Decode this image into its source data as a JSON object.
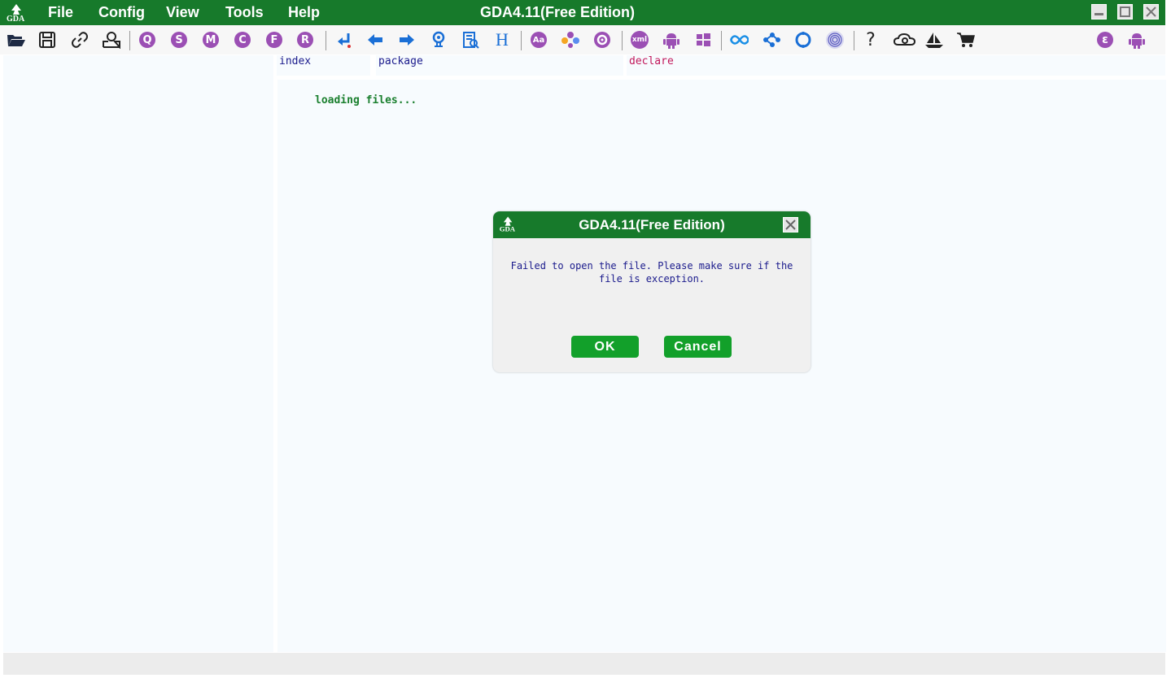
{
  "window": {
    "title": "GDA4.11(Free Edition)",
    "menu": [
      "File",
      "Config",
      "View",
      "Tools",
      "Help"
    ],
    "controls": [
      "minimize-icon",
      "maximize-icon",
      "close-icon"
    ]
  },
  "toolbar": {
    "letter_buttons": [
      "Q",
      "S",
      "M",
      "C",
      "F",
      "R"
    ],
    "icons": [
      "open-folder-icon",
      "save-icon",
      "link-icon",
      "profile-icon",
      "search-q-icon",
      "search-s-icon",
      "search-m-icon",
      "search-c-icon",
      "search-f-icon",
      "search-r-icon",
      "jump-icon",
      "back-arrow-icon",
      "forward-arrow-icon",
      "location-icon",
      "report-icon",
      "heading-icon",
      "font-icon",
      "graph-icon",
      "gear-icon",
      "xml-icon",
      "android-icon",
      "windows-icon",
      "infinity-icon",
      "nodes-icon",
      "ring-icon",
      "fingerprint-icon",
      "help-icon",
      "cloud-icon",
      "ship-icon",
      "cart-icon",
      "epsilon-icon",
      "android-right-icon"
    ],
    "xml_label": "xml",
    "heading_label": "H",
    "font_label": "Aa",
    "help_label": "?",
    "epsilon_label": "ε"
  },
  "columns": {
    "index": "index",
    "package": "package",
    "declare": "declare"
  },
  "main": {
    "loading_text": "loading files..."
  },
  "dialog": {
    "title": "GDA4.11(Free Edition)",
    "message": "Failed to open the file. Please make sure if the file is exception.",
    "ok_label": "OK",
    "cancel_label": "Cancel"
  },
  "colors": {
    "titlebar": "#177a2b",
    "button_green": "#12a02a",
    "purple": "#9b4fb4",
    "blue": "#1a6fd6",
    "declare_text": "#c2185b",
    "index_text": "#1a1a8c"
  }
}
